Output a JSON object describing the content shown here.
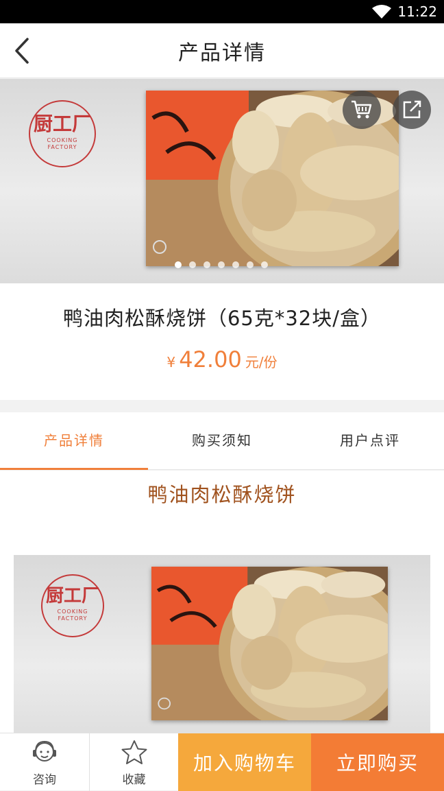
{
  "status": {
    "time": "11:22"
  },
  "nav": {
    "title": "产品详情"
  },
  "hero": {
    "logo_cn": "厨工厂",
    "logo_en_1": "COOKING",
    "logo_en_2": "FACTORY",
    "slide_count": 7,
    "active_slide": 1
  },
  "product": {
    "name": "鸭油肉松酥烧饼（65克*32块/盒）",
    "currency": "¥",
    "price": "42.00",
    "unit": "元/份"
  },
  "tabs": [
    {
      "label": "产品详情",
      "active": true
    },
    {
      "label": "购买须知",
      "active": false
    },
    {
      "label": "用户点评",
      "active": false
    }
  ],
  "content": {
    "heading": "鸭油肉松酥烧饼"
  },
  "bottom": {
    "consult_label": "咨询",
    "favorite_label": "收藏",
    "add_cart_label": "加入购物车",
    "buy_now_label": "立即购买"
  },
  "colors": {
    "accent": "#f07f3a",
    "cart_button": "#f5a83c",
    "buy_button": "#f37c35",
    "heading": "#a0521e",
    "logo": "#c43a3a"
  }
}
